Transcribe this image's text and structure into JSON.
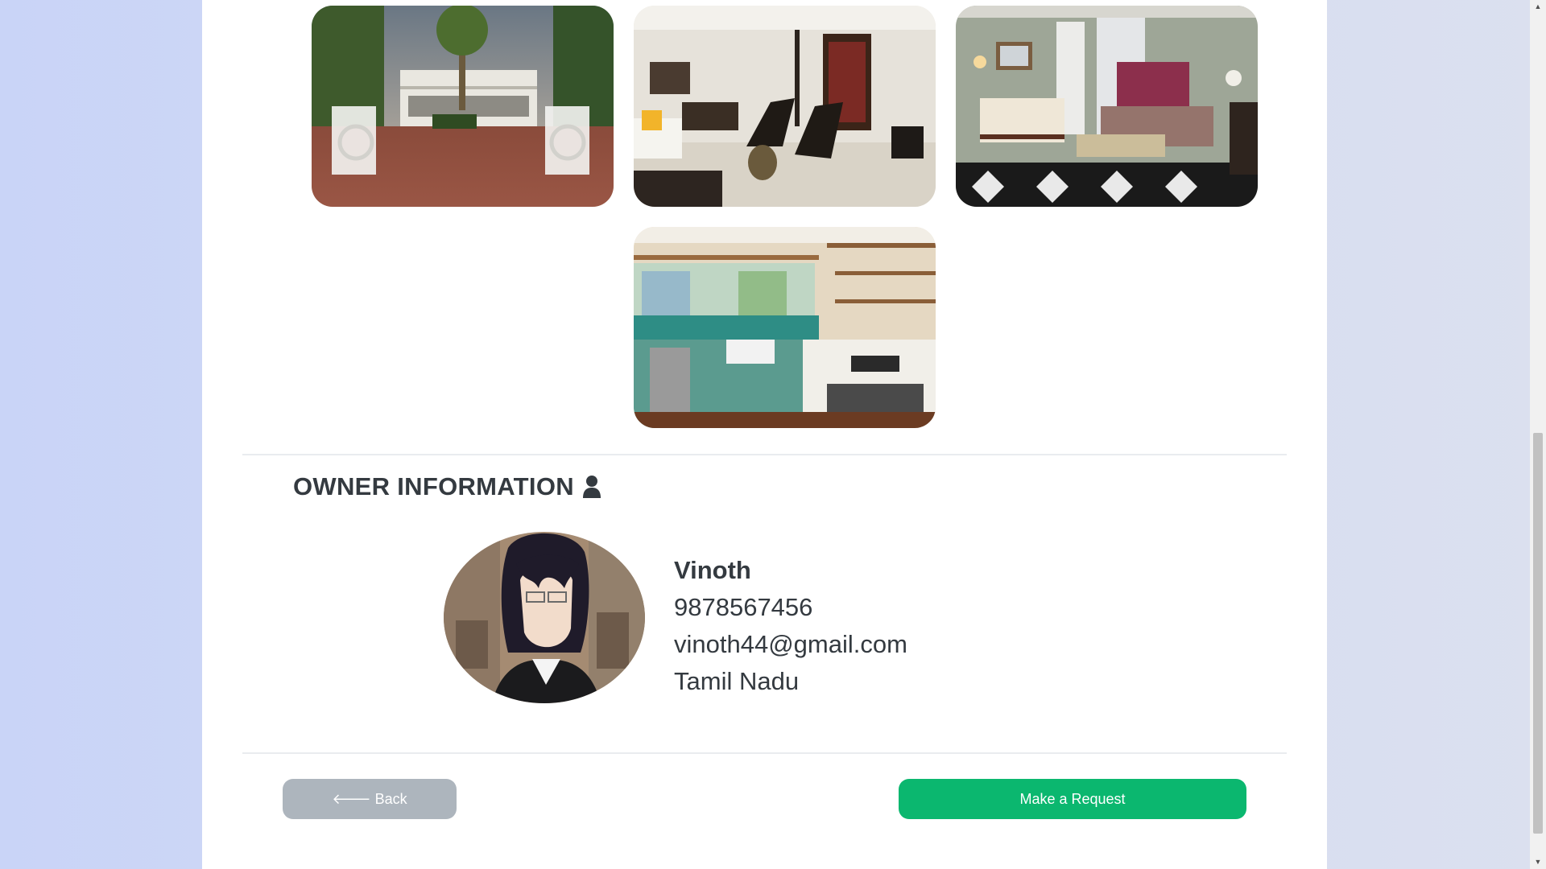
{
  "gallery": [
    {
      "alt": "Villa entrance with palm trees"
    },
    {
      "alt": "Living room with swing and chairs"
    },
    {
      "alt": "Bedroom with patterned rug"
    },
    {
      "alt": "Kitchen with open shelves"
    }
  ],
  "owner": {
    "section_title": "OWNER INFORMATION",
    "icon": "user-icon",
    "name": "Vinoth",
    "phone": "9878567456",
    "email": "vinoth44@gmail.com",
    "location": "Tamil Nadu"
  },
  "actions": {
    "back_label": "Back",
    "back_icon": "arrow-left-icon",
    "request_label": "Make a Request"
  },
  "colors": {
    "primary_green": "#0bb76f",
    "secondary_grey": "#adb5bd",
    "text_dark": "#343a40"
  }
}
